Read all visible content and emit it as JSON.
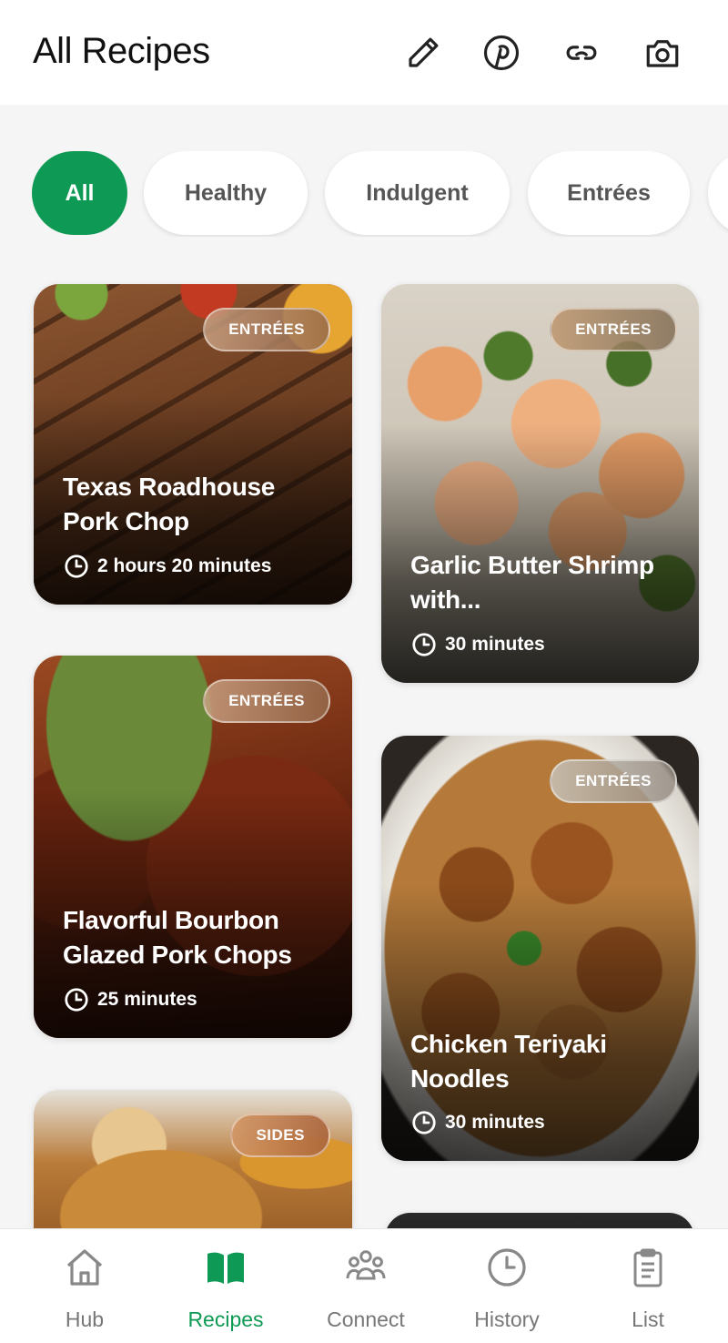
{
  "header": {
    "title": "All Recipes",
    "actions": [
      {
        "icon": "pencil-icon"
      },
      {
        "icon": "pinterest-icon"
      },
      {
        "icon": "link-icon"
      },
      {
        "icon": "camera-icon"
      }
    ]
  },
  "filters": [
    {
      "label": "All",
      "active": true
    },
    {
      "label": "Healthy",
      "active": false
    },
    {
      "label": "Indulgent",
      "active": false
    },
    {
      "label": "Entrées",
      "active": false
    }
  ],
  "recipes": [
    {
      "title": "Texas Roadhouse Pork Chop",
      "category": "ENTRÉES",
      "time": "2 hours 20 minutes"
    },
    {
      "title": "Garlic Butter Shrimp with...",
      "category": "ENTRÉES",
      "time": "30 minutes"
    },
    {
      "title": "Flavorful Bourbon Glazed Pork Chops",
      "category": "ENTRÉES",
      "time": "25 minutes"
    },
    {
      "title": "Chicken Teriyaki Noodles",
      "category": "ENTRÉES",
      "time": "30 minutes"
    },
    {
      "title": "",
      "category": "SIDES",
      "time": ""
    }
  ],
  "nav": [
    {
      "label": "Hub",
      "icon": "home-icon",
      "active": false
    },
    {
      "label": "Recipes",
      "icon": "book-icon",
      "active": true
    },
    {
      "label": "Connect",
      "icon": "people-icon",
      "active": false
    },
    {
      "label": "History",
      "icon": "clock-icon",
      "active": false
    },
    {
      "label": "List",
      "icon": "clipboard-icon",
      "active": false
    }
  ],
  "colors": {
    "accent": "#0e9a54",
    "inactive_nav": "#777777"
  }
}
